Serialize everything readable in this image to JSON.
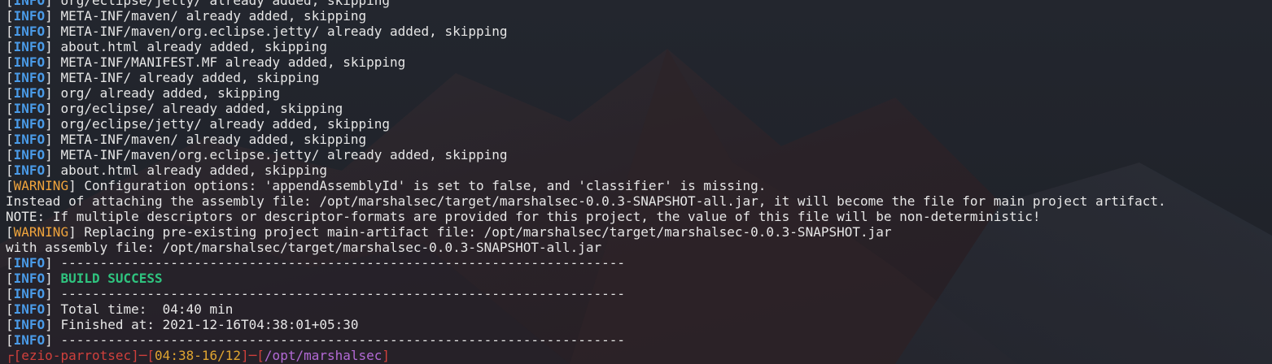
{
  "terminal": {
    "lines": [
      {
        "tag": "INFO",
        "text": "org/eclipse/jetty/ already added, skipping"
      },
      {
        "tag": "INFO",
        "text": "META-INF/maven/ already added, skipping"
      },
      {
        "tag": "INFO",
        "text": "META-INF/maven/org.eclipse.jetty/ already added, skipping"
      },
      {
        "tag": "INFO",
        "text": "about.html already added, skipping"
      },
      {
        "tag": "INFO",
        "text": "META-INF/MANIFEST.MF already added, skipping"
      },
      {
        "tag": "INFO",
        "text": "META-INF/ already added, skipping"
      },
      {
        "tag": "INFO",
        "text": "org/ already added, skipping"
      },
      {
        "tag": "INFO",
        "text": "org/eclipse/ already added, skipping"
      },
      {
        "tag": "INFO",
        "text": "org/eclipse/jetty/ already added, skipping"
      },
      {
        "tag": "INFO",
        "text": "META-INF/maven/ already added, skipping"
      },
      {
        "tag": "INFO",
        "text": "META-INF/maven/org.eclipse.jetty/ already added, skipping"
      },
      {
        "tag": "INFO",
        "text": "about.html already added, skipping"
      },
      {
        "tag": "WARNING",
        "text": "Configuration options: 'appendAssemblyId' is set to false, and 'classifier' is missing."
      },
      {
        "tag": "",
        "text": "Instead of attaching the assembly file: /opt/marshalsec/target/marshalsec-0.0.3-SNAPSHOT-all.jar, it will become the file for main project artifact."
      },
      {
        "tag": "",
        "text": "NOTE: If multiple descriptors or descriptor-formats are provided for this project, the value of this file will be non-deterministic!"
      },
      {
        "tag": "WARNING",
        "text": "Replacing pre-existing project main-artifact file: /opt/marshalsec/target/marshalsec-0.0.3-SNAPSHOT.jar"
      },
      {
        "tag": "",
        "text": "with assembly file: /opt/marshalsec/target/marshalsec-0.0.3-SNAPSHOT-all.jar"
      },
      {
        "tag": "INFO",
        "text": "------------------------------------------------------------------------"
      },
      {
        "tag": "INFO",
        "text": "BUILD SUCCESS",
        "style": "success"
      },
      {
        "tag": "INFO",
        "text": "------------------------------------------------------------------------"
      },
      {
        "tag": "INFO",
        "text": "Total time:  04:40 min"
      },
      {
        "tag": "INFO",
        "text": "Finished at: 2021-12-16T04:38:01+05:30"
      },
      {
        "tag": "INFO",
        "text": "------------------------------------------------------------------------"
      }
    ],
    "prompt": {
      "open_corner": "┌",
      "user": "ezio-parrotsec",
      "time": "04:38-16/12",
      "path": "/opt/marshalsec"
    }
  },
  "colors": {
    "background": "#1d2027",
    "info": "#4a9be8",
    "warning": "#f0a43c",
    "success": "#2fc47f",
    "prompt_frame": "#d0403c",
    "prompt_time": "#e0a530",
    "prompt_path": "#b36ad6"
  }
}
